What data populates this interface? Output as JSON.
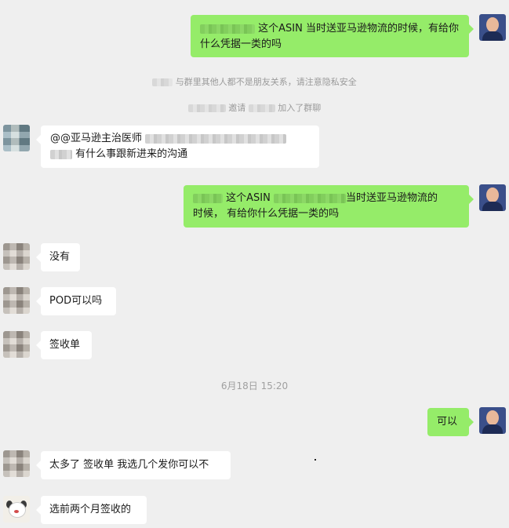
{
  "messages": {
    "m1": {
      "text": "这个ASIN 当时送亚马逊物流的时候，有给你什么凭据一类的吗"
    },
    "sys1": {
      "text": "与群里其他人都不是朋友关系，请注意隐私安全"
    },
    "sys2": {
      "mid": "邀请",
      "end": "加入了群聊"
    },
    "m2": {
      "line1": "@@亚马逊主治医师",
      "line2": "有什么事跟新进来的沟通"
    },
    "m3": {
      "part1": "这个ASIN",
      "part2": "当时送亚马逊物流的",
      "line2": "时候， 有给你什么凭据一类的吗"
    },
    "m4": {
      "text": "没有"
    },
    "m5": {
      "text": "POD可以吗"
    },
    "m6": {
      "text": "签收单"
    },
    "timestamp": {
      "text": "6月18日 15:20"
    },
    "m7": {
      "text": "可以"
    },
    "m8": {
      "text": "太多了 签收单 我选几个发你可以不"
    },
    "m9": {
      "text": "选前两个月签收的"
    }
  }
}
